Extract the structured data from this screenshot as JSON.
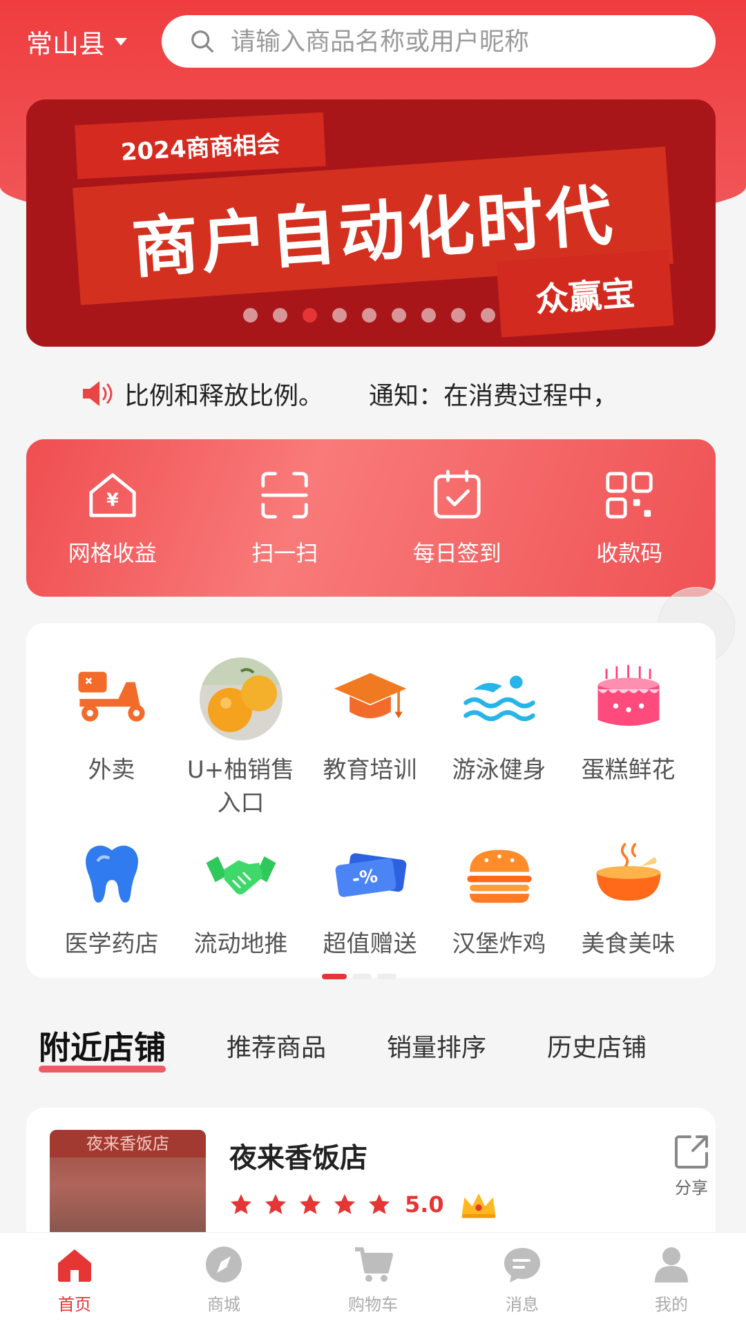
{
  "header": {
    "location": "常山县",
    "search_placeholder": "请输入商品名称或用户昵称"
  },
  "banner": {
    "tag": "2024商商相会",
    "headline": "商户自动化时代",
    "brand": "众赢宝",
    "slide_count": 9,
    "active_slide": 3
  },
  "notice": {
    "text_part1": "比例和释放比例。",
    "text_part2": "通知：在消费过程中，"
  },
  "quick_actions": [
    {
      "label": "网格收益",
      "icon": "wallet-house-icon"
    },
    {
      "label": "扫一扫",
      "icon": "scan-icon"
    },
    {
      "label": "每日签到",
      "icon": "calendar-check-icon"
    },
    {
      "label": "收款码",
      "icon": "qr-code-icon"
    }
  ],
  "categories": [
    {
      "label": "外卖",
      "icon": "scooter-icon"
    },
    {
      "label": "U+柚销售入口",
      "icon": "grapefruit-photo-icon"
    },
    {
      "label": "教育培训",
      "icon": "graduation-cap-icon"
    },
    {
      "label": "游泳健身",
      "icon": "swim-waves-icon"
    },
    {
      "label": "蛋糕鲜花",
      "icon": "cake-icon"
    },
    {
      "label": "医学药店",
      "icon": "tooth-icon"
    },
    {
      "label": "流动地推",
      "icon": "handshake-icon"
    },
    {
      "label": "超值赠送",
      "icon": "coupon-icon"
    },
    {
      "label": "汉堡炸鸡",
      "icon": "burger-icon"
    },
    {
      "label": "美食美味",
      "icon": "food-bowl-icon"
    }
  ],
  "tabs": [
    {
      "label": "附近店铺",
      "active": true
    },
    {
      "label": "推荐商品",
      "active": false
    },
    {
      "label": "销量排序",
      "active": false
    },
    {
      "label": "历史店铺",
      "active": false
    }
  ],
  "store": {
    "name": "夜来香饭店",
    "photo_sign": "夜来香饭店",
    "rating": "5.0",
    "stars": 5,
    "share_label": "分享"
  },
  "tabbar": [
    {
      "label": "首页",
      "icon": "home-icon",
      "active": true
    },
    {
      "label": "商城",
      "icon": "compass-icon",
      "active": false
    },
    {
      "label": "购物车",
      "icon": "cart-icon",
      "active": false
    },
    {
      "label": "消息",
      "icon": "message-icon",
      "active": false
    },
    {
      "label": "我的",
      "icon": "user-icon",
      "active": false
    }
  ],
  "colors": {
    "primary": "#ef3d3f",
    "accent_pink": "#f05a66",
    "banner_dark": "#a9161a"
  }
}
